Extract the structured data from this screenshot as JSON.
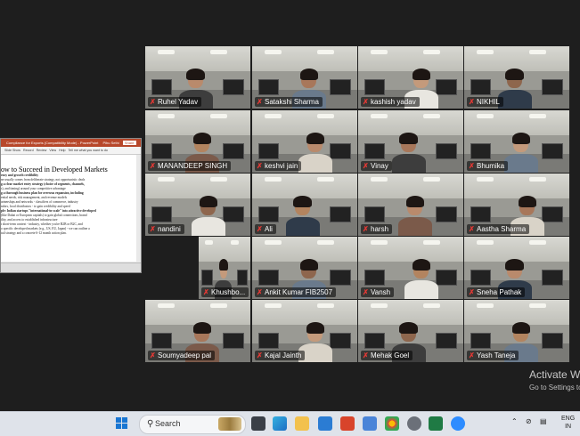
{
  "powerpoint": {
    "title_bar": "Compliance for Exports (Compatibility Mode) - PowerPoint",
    "user": "Pihu Sethi",
    "share": "Share",
    "ribbon_tabs": [
      "Slide Show",
      "Record",
      "Review",
      "View",
      "Help",
      "Tell me what you want to do"
    ],
    "slide_heading": "ow to Succeed in Developed Markets",
    "slide_lines": [
      {
        "text": "ency and growth credibility",
        "bold": true
      },
      {
        "text": "ne usually comes from deliberate strategy, not opportunistic deals",
        "bold": false
      },
      {
        "text": "g a clear market entry strategy (choice of segments, channels,",
        "bold": true
      },
      {
        "text": "s), and timing) around your competitive advantage",
        "bold": false
      },
      {
        "text": "g a thorough business plan for overseas expansion, including",
        "bold": true
      },
      {
        "text": "ential needs, risk management, and revenue models",
        "bold": false
      },
      {
        "text": "artnerships and networks - classifiers of commerce, industry",
        "bold": false
      },
      {
        "text": "ndors, local distributors - to gain credibility and speed",
        "bold": false
      },
      {
        "text": "ple: Indian startups \"international-in-scale\" into attractive developed",
        "bold": true
      },
      {
        "text": "(like Dubai or European capitals) to gain global connections, brand",
        "bold": false
      },
      {
        "text": "ility, and access to established infrastructure",
        "bold": false
      },
      {
        "text": "t short-term context - industry, whether you're B2B or B2C, and",
        "bold": false
      },
      {
        "text": "o specific developed markets (e.g., US, EU, Japan) - we can outline a",
        "bold": false
      },
      {
        "text": "tail strategy and a concrete 6-12 month action plan.",
        "bold": false
      }
    ]
  },
  "participants": [
    {
      "name": "Ruhel Yadav",
      "muted": true
    },
    {
      "name": "Satakshi Sharma",
      "muted": true
    },
    {
      "name": "kashish yadav",
      "muted": true
    },
    {
      "name": "NIKHIL",
      "muted": true
    },
    {
      "name": "MANANDEEP SINGH",
      "muted": true
    },
    {
      "name": "keshvi jain",
      "muted": true
    },
    {
      "name": "Vinay",
      "muted": true
    },
    {
      "name": "Bhumika",
      "muted": true
    },
    {
      "name": "nandini",
      "muted": true
    },
    {
      "name": "Ali",
      "muted": true
    },
    {
      "name": "harsh",
      "muted": true
    },
    {
      "name": "Aastha Sharma",
      "muted": true
    },
    {
      "name": "Khushbo...",
      "muted": true
    },
    {
      "name": "Ankit Kumar FIB2507",
      "muted": true
    },
    {
      "name": "Vansh",
      "muted": true
    },
    {
      "name": "Sneha Pathak",
      "muted": true
    },
    {
      "name": "Soumyadeep pal",
      "muted": true
    },
    {
      "name": "Kajal Jainth",
      "muted": true
    },
    {
      "name": "Mehak Goel",
      "muted": true
    },
    {
      "name": "Yash Taneja",
      "muted": true
    }
  ],
  "watermark": {
    "line1": "Activate Wi",
    "line2": "Go to Settings to"
  },
  "taskbar": {
    "search_label": "Search",
    "language_line1": "ENG",
    "language_line2": "IN"
  },
  "colors": {
    "muted_icon": "#e53935",
    "ppt_brand": "#b7472a",
    "start_blue": "#1976d2"
  }
}
